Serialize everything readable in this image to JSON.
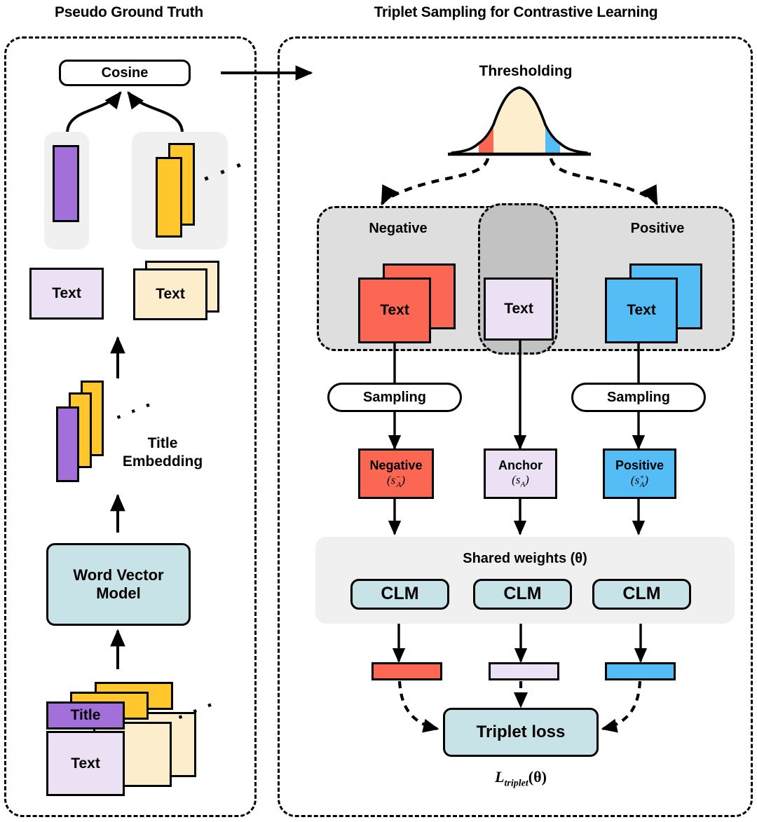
{
  "panels": {
    "left": {
      "title": "Pseudo Ground Truth"
    },
    "right": {
      "title": "Triplet Sampling for Contrastive Learning"
    }
  },
  "left_panel": {
    "cosine_label": "Cosine",
    "anchor_text_label": "Text",
    "candidate_text_label": "Text",
    "ellipsis": "· · ·",
    "title_embedding_label": "Title\nEmbedding",
    "title_embedding_line1": "Title",
    "title_embedding_line2": "Embedding",
    "word_vector_line1": "Word Vector",
    "word_vector_line2": "Model",
    "doc_title_label": "Title",
    "doc_text_label": "Text"
  },
  "right_panel": {
    "thresholding_label": "Thresholding",
    "negative_group_label": "Negative",
    "positive_group_label": "Positive",
    "negative_text_label": "Text",
    "anchor_text_label": "Text",
    "positive_text_label": "Text",
    "sampling_left_label": "Sampling",
    "sampling_right_label": "Sampling",
    "negative_box": {
      "name": "Negative",
      "symbol_base": "s",
      "symbol_sub": "A",
      "symbol_sup": "−"
    },
    "anchor_box": {
      "name": "Anchor",
      "symbol_base": "s",
      "symbol_sub": "A",
      "symbol_sup": ""
    },
    "positive_box": {
      "name": "Positive",
      "symbol_base": "s",
      "symbol_sub": "A",
      "symbol_sup": "+"
    },
    "shared_weights_label": "Shared weights (θ)",
    "clm_left_label": "CLM",
    "clm_mid_label": "CLM",
    "clm_right_label": "CLM",
    "triplet_loss_label": "Triplet loss",
    "loss_formula_main": "L",
    "loss_formula_sub": "triplet",
    "loss_formula_arg": "(θ)"
  },
  "colors": {
    "purple": "#a370da",
    "yellow": "#ffc72c",
    "light_lavender": "#ece0f5",
    "light_cream": "#fceecd",
    "red": "#fb6752",
    "blue": "#55bdf5",
    "teal": "#c8e3e7",
    "curve_fill": "#fdeecd",
    "soft_gray": "#f0f0f0",
    "group_gray": "#dedede",
    "anchor_gray": "#c2c2c2",
    "outline": "#000000",
    "background": "#ffffff"
  },
  "chart_data": {
    "type": "area",
    "title": "Thresholding",
    "description": "Gaussian distribution of cosine similarity scores with left tail shaded red (negatives), centre shaded cream (ignored), right tail shaded blue (positives).",
    "xlabel": "",
    "ylabel": "",
    "regions": [
      {
        "name": "negative-tail",
        "color": "#fb6752",
        "range": [
          -3.0,
          -1.45
        ]
      },
      {
        "name": "middle",
        "color": "#fdeecd",
        "range": [
          -1.45,
          1.45
        ]
      },
      {
        "name": "positive-tail",
        "color": "#55bdf5",
        "range": [
          1.45,
          3.0
        ]
      }
    ],
    "curve": "normal(mu=0, sigma=1)",
    "xlim": [
      -3.6,
      3.6
    ],
    "ylim": [
      0,
      1
    ],
    "grid": false,
    "legend": "none"
  }
}
